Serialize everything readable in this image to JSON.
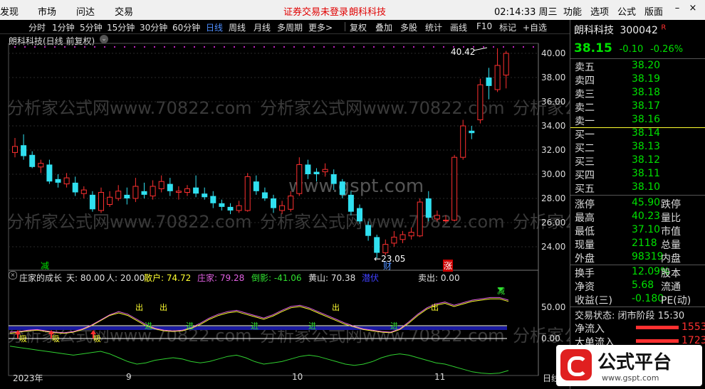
{
  "menubar": {
    "items": [
      "发现",
      "市场",
      "问达",
      "交易"
    ],
    "warning": "证券交易未登录",
    "stock_name": "朗科科技",
    "clock": "02:14:33",
    "weekday": "周三",
    "right_items": [
      "功能",
      "选项",
      "公式",
      "版面"
    ]
  },
  "toolbar": {
    "periods": [
      "分时",
      "1分钟",
      "5分钟",
      "15分钟",
      "30分钟",
      "60分钟",
      "日线",
      "周线",
      "月线",
      "多周期",
      "更多"
    ],
    "active_period": "日线",
    "tools": [
      "复权",
      "叠加",
      "多股",
      "统计",
      "画线",
      "F10",
      "标记",
      "+自选"
    ]
  },
  "chart": {
    "title": "朗科科技(日线 前复权)",
    "y_ticks": [
      "40.00",
      "38.00",
      "36.00",
      "34.00",
      "32.00",
      "30.00",
      "28.00",
      "26.00",
      "24.00"
    ],
    "high_label": "40.42",
    "low_label": "23.05",
    "marker_jian": "减",
    "marker_cai": "财",
    "marker_zhang": "涨",
    "watermark_1": "分析家公式网www.70822.com",
    "watermark_2": "www.gspt.com"
  },
  "candles": [
    {
      "o": 31.8,
      "c": 32.3,
      "h": 33.0,
      "l": 31.4
    },
    {
      "o": 32.4,
      "c": 31.5,
      "h": 33.3,
      "l": 31.2
    },
    {
      "o": 31.6,
      "c": 30.6,
      "h": 31.9,
      "l": 30.5
    },
    {
      "o": 30.6,
      "c": 30.9,
      "h": 31.2,
      "l": 30.1
    },
    {
      "o": 30.8,
      "c": 29.4,
      "h": 31.2,
      "l": 29.2
    },
    {
      "o": 29.6,
      "c": 29.3,
      "h": 30.0,
      "l": 28.9
    },
    {
      "o": 29.2,
      "c": 29.7,
      "h": 30.1,
      "l": 28.9
    },
    {
      "o": 29.3,
      "c": 28.5,
      "h": 29.8,
      "l": 28.2
    },
    {
      "o": 28.4,
      "c": 28.7,
      "h": 29.0,
      "l": 28.0
    },
    {
      "o": 28.3,
      "c": 27.1,
      "h": 28.6,
      "l": 26.9
    },
    {
      "o": 27.0,
      "c": 28.5,
      "h": 28.9,
      "l": 26.8
    },
    {
      "o": 27.5,
      "c": 28.1,
      "h": 28.6,
      "l": 27.3
    },
    {
      "o": 28.0,
      "c": 28.6,
      "h": 29.1,
      "l": 27.8
    },
    {
      "o": 28.3,
      "c": 28.0,
      "h": 28.9,
      "l": 27.5
    },
    {
      "o": 28.0,
      "c": 29.0,
      "h": 29.7,
      "l": 27.7
    },
    {
      "o": 28.6,
      "c": 28.3,
      "h": 29.3,
      "l": 28.0
    },
    {
      "o": 28.2,
      "c": 29.0,
      "h": 29.5,
      "l": 27.9
    },
    {
      "o": 28.8,
      "c": 29.4,
      "h": 29.9,
      "l": 28.5
    },
    {
      "o": 29.2,
      "c": 28.6,
      "h": 29.7,
      "l": 28.2
    },
    {
      "o": 28.5,
      "c": 28.6,
      "h": 29.0,
      "l": 27.9
    },
    {
      "o": 28.5,
      "c": 28.8,
      "h": 29.1,
      "l": 28.2
    },
    {
      "o": 28.9,
      "c": 28.4,
      "h": 29.9,
      "l": 28.1
    },
    {
      "o": 28.4,
      "c": 28.1,
      "h": 28.9,
      "l": 27.9
    },
    {
      "o": 28.2,
      "c": 27.6,
      "h": 28.6,
      "l": 27.2
    },
    {
      "o": 27.6,
      "c": 27.3,
      "h": 27.9,
      "l": 27.0
    },
    {
      "o": 27.3,
      "c": 27.0,
      "h": 27.6,
      "l": 26.7
    },
    {
      "o": 27.0,
      "c": 27.4,
      "h": 27.8,
      "l": 26.8
    },
    {
      "o": 27.0,
      "c": 29.8,
      "h": 30.1,
      "l": 26.9
    },
    {
      "o": 29.4,
      "c": 28.6,
      "h": 29.9,
      "l": 28.3
    },
    {
      "o": 28.5,
      "c": 28.0,
      "h": 28.9,
      "l": 27.8
    },
    {
      "o": 28.0,
      "c": 27.2,
      "h": 28.3,
      "l": 26.8
    },
    {
      "o": 27.0,
      "c": 27.4,
      "h": 27.8,
      "l": 26.7
    },
    {
      "o": 27.1,
      "c": 28.2,
      "h": 28.6,
      "l": 26.9
    },
    {
      "o": 28.4,
      "c": 30.8,
      "h": 31.4,
      "l": 28.2
    },
    {
      "o": 30.8,
      "c": 30.0,
      "h": 31.2,
      "l": 29.6
    },
    {
      "o": 30.2,
      "c": 30.0,
      "h": 30.5,
      "l": 29.4
    },
    {
      "o": 30.2,
      "c": 30.4,
      "h": 30.9,
      "l": 29.8
    },
    {
      "o": 30.0,
      "c": 29.2,
      "h": 30.4,
      "l": 28.7
    },
    {
      "o": 29.4,
      "c": 28.3,
      "h": 29.6,
      "l": 28.0
    },
    {
      "o": 28.3,
      "c": 26.9,
      "h": 28.6,
      "l": 26.6
    },
    {
      "o": 27.2,
      "c": 26.1,
      "h": 27.5,
      "l": 25.9
    },
    {
      "o": 25.8,
      "c": 24.9,
      "h": 26.1,
      "l": 24.5
    },
    {
      "o": 24.8,
      "c": 23.5,
      "h": 25.0,
      "l": 23.05
    },
    {
      "o": 23.5,
      "c": 24.2,
      "h": 24.6,
      "l": 23.3
    },
    {
      "o": 24.3,
      "c": 24.8,
      "h": 25.3,
      "l": 24.0
    },
    {
      "o": 24.6,
      "c": 25.0,
      "h": 25.3,
      "l": 24.3
    },
    {
      "o": 24.9,
      "c": 25.2,
      "h": 25.6,
      "l": 24.6
    },
    {
      "o": 24.9,
      "c": 27.7,
      "h": 28.0,
      "l": 24.8
    },
    {
      "o": 28.0,
      "c": 26.4,
      "h": 28.6,
      "l": 26.1
    },
    {
      "o": 26.3,
      "c": 26.6,
      "h": 27.0,
      "l": 26.1
    },
    {
      "o": 26.2,
      "c": 26.2,
      "h": 26.6,
      "l": 26.0
    },
    {
      "o": 26.2,
      "c": 31.4,
      "h": 31.6,
      "l": 26.1
    },
    {
      "o": 31.4,
      "c": 34.0,
      "h": 34.5,
      "l": 31.2
    },
    {
      "o": 33.6,
      "c": 33.4,
      "h": 34.0,
      "l": 32.9
    },
    {
      "o": 34.5,
      "c": 37.4,
      "h": 37.9,
      "l": 34.2
    },
    {
      "o": 38.0,
      "c": 37.3,
      "h": 38.8,
      "l": 36.2
    },
    {
      "o": 37.0,
      "c": 39.0,
      "h": 40.42,
      "l": 36.8
    },
    {
      "o": 38.2,
      "c": 40.0,
      "h": 40.2,
      "l": 37.1
    }
  ],
  "indicator": {
    "title": "庄家的成长",
    "tian": "天: 80.00",
    "ren": "人: 20.00",
    "sanhu": "散户: 74.72",
    "zhuangjia": "庄家: 79.28",
    "daoying": "倒影: -41.06",
    "huangshan": "黄山: 70.38",
    "hidden_label": "潜伏",
    "chu_label": "卖出: 0.00",
    "y_ticks": [
      "50.00",
      "0.00"
    ],
    "marks_jin": "进",
    "marks_chu": "出",
    "marks_xi": "吸",
    "marks_jian": "减",
    "sanhu_series": [
      8,
      10,
      12,
      13,
      11,
      9,
      8,
      10,
      14,
      20,
      28,
      36,
      40,
      36,
      28,
      20,
      15,
      12,
      11,
      12,
      16,
      22,
      30,
      36,
      40,
      42,
      38,
      34,
      30,
      35,
      42,
      48,
      50,
      46,
      40,
      34,
      28,
      22,
      18,
      14,
      12,
      10,
      9,
      14,
      24,
      36,
      46,
      52,
      55,
      50,
      54,
      58,
      60,
      62,
      62,
      58
    ],
    "zhuangjia_series": [
      10,
      11,
      13,
      14,
      12,
      10,
      9,
      11,
      15,
      21,
      29,
      37,
      42,
      38,
      30,
      22,
      16,
      13,
      12,
      13,
      17,
      24,
      32,
      38,
      42,
      44,
      40,
      36,
      32,
      37,
      44,
      50,
      52,
      48,
      42,
      36,
      30,
      24,
      19,
      15,
      13,
      11,
      10,
      15,
      26,
      38,
      48,
      54,
      57,
      52,
      56,
      60,
      62,
      64,
      64,
      60
    ],
    "daoying_series": [
      -12,
      -14,
      -16,
      -18,
      -20,
      -22,
      -24,
      -26,
      -24,
      -22,
      -20,
      -24,
      -30,
      -36,
      -40,
      -38,
      -34,
      -32,
      -30,
      -32,
      -36,
      -38,
      -36,
      -32,
      -28,
      -26,
      -30,
      -36,
      -40,
      -38,
      -36,
      -32,
      -28,
      -26,
      -28,
      -32,
      -36,
      -40,
      -42,
      -40,
      -36,
      -30,
      -26,
      -24,
      -26,
      -30,
      -34,
      -38,
      -40,
      -44,
      -48,
      -52,
      -54,
      -55,
      -54,
      -50
    ]
  },
  "x_axis": [
    "2023年",
    "9",
    "10",
    "11",
    "日线"
  ],
  "quote": {
    "name": "朗科科技",
    "code": "300042",
    "flag": "R",
    "price": "38.15",
    "change": "-0.10",
    "pct": "-0.26%",
    "sell": [
      {
        "label": "卖五",
        "price": "38.20"
      },
      {
        "label": "卖四",
        "price": "38.19"
      },
      {
        "label": "卖三",
        "price": "38.18"
      },
      {
        "label": "卖二",
        "price": "38.17"
      },
      {
        "label": "卖一",
        "price": "38.16"
      }
    ],
    "buy": [
      {
        "label": "买一",
        "price": "38.14"
      },
      {
        "label": "买二",
        "price": "38.13"
      },
      {
        "label": "买三",
        "price": "38.12"
      },
      {
        "label": "买四",
        "price": "38.11"
      },
      {
        "label": "买五",
        "price": "38.10"
      }
    ],
    "stats": [
      {
        "label": "涨停",
        "value": "45.90",
        "color": "red",
        "label2": "跌停"
      },
      {
        "label": "最高",
        "value": "40.23",
        "color": "red",
        "label2": "量比"
      },
      {
        "label": "最低",
        "value": "37.10",
        "color": "green",
        "label2": "市值"
      },
      {
        "label": "现量",
        "value": "2118",
        "color": "purple",
        "label2": "总量"
      },
      {
        "label": "外盘",
        "value": "98319",
        "color": "red",
        "label2": "内盘"
      }
    ],
    "stats2": [
      {
        "label": "换手",
        "value": "12.09%",
        "label2": "股本"
      },
      {
        "label": "净资",
        "value": "5.68",
        "label2": "流通"
      },
      {
        "label": "收益(三)",
        "value": "-0.180",
        "label2": "PE(动)"
      }
    ],
    "status_label": "交易状态:",
    "status_value": "闭市阶段",
    "status_time": "15:30",
    "net_inflow_label": "净流入",
    "net_inflow_value": "1553",
    "big_inflow_label": "大单流入",
    "big_inflow_value": "1723"
  },
  "logo": {
    "text": "公式平台",
    "url": "www.gspt.com"
  }
}
